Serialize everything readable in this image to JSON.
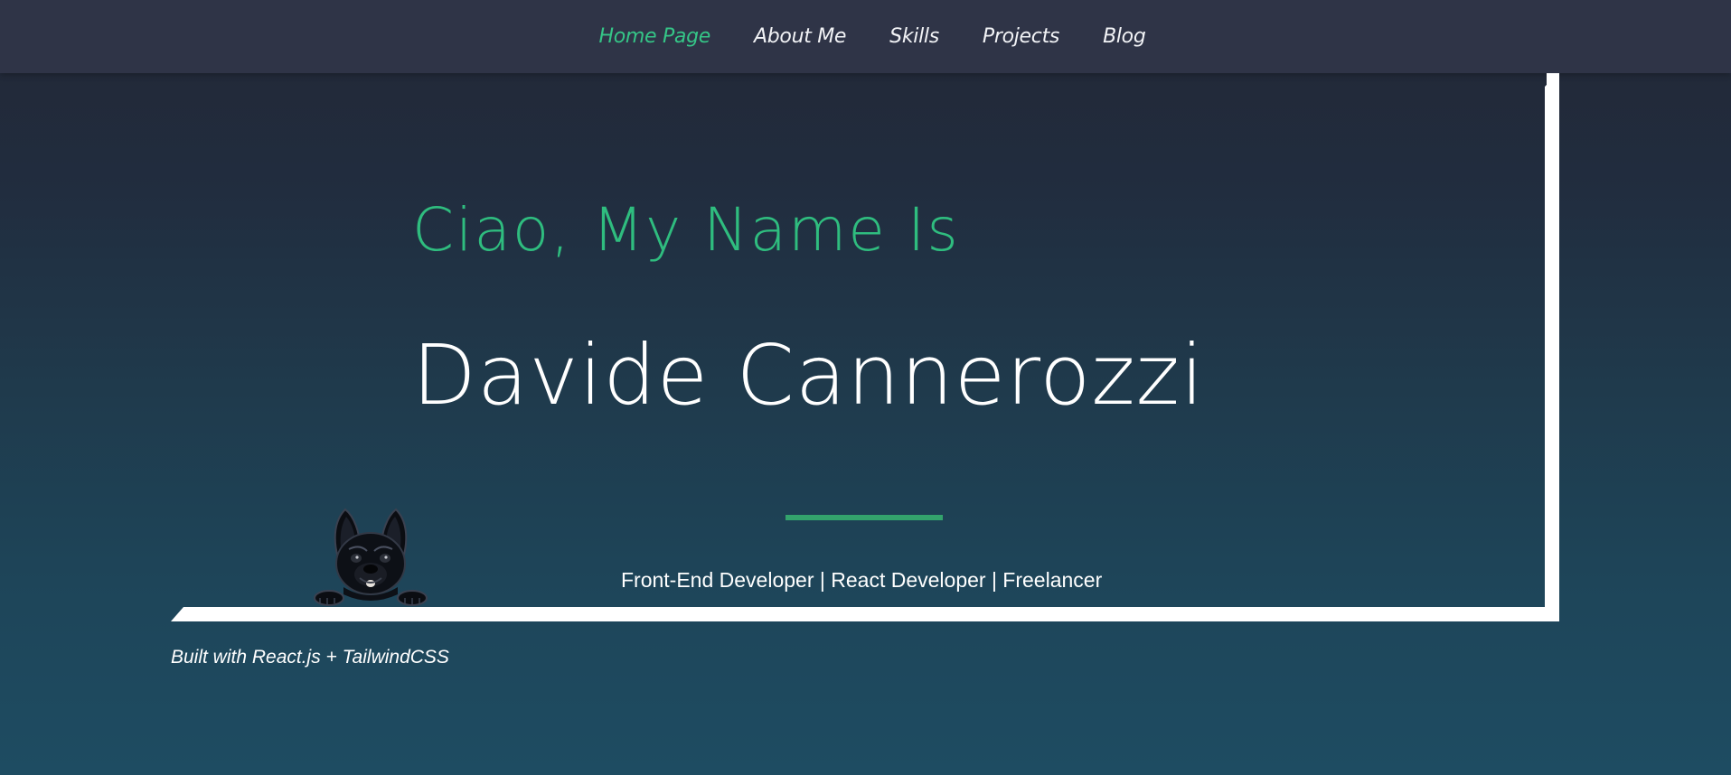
{
  "nav": {
    "items": [
      {
        "label": "Home Page",
        "active": true
      },
      {
        "label": "About Me",
        "active": false
      },
      {
        "label": "Skills",
        "active": false
      },
      {
        "label": "Projects",
        "active": false
      },
      {
        "label": "Blog",
        "active": false
      }
    ]
  },
  "hero": {
    "greeting": "Ciao, My Name Is",
    "name": "Davide Cannerozzi",
    "roles": "Front-End Developer | React Developer | Freelancer"
  },
  "footer": {
    "note": "Built with React.js + TailwindCSS"
  },
  "colors": {
    "accent": "#35c587",
    "nav_background": "#2f3447",
    "frame": "#ffffff"
  },
  "icons": {
    "mascot": "french-bulldog-icon"
  }
}
